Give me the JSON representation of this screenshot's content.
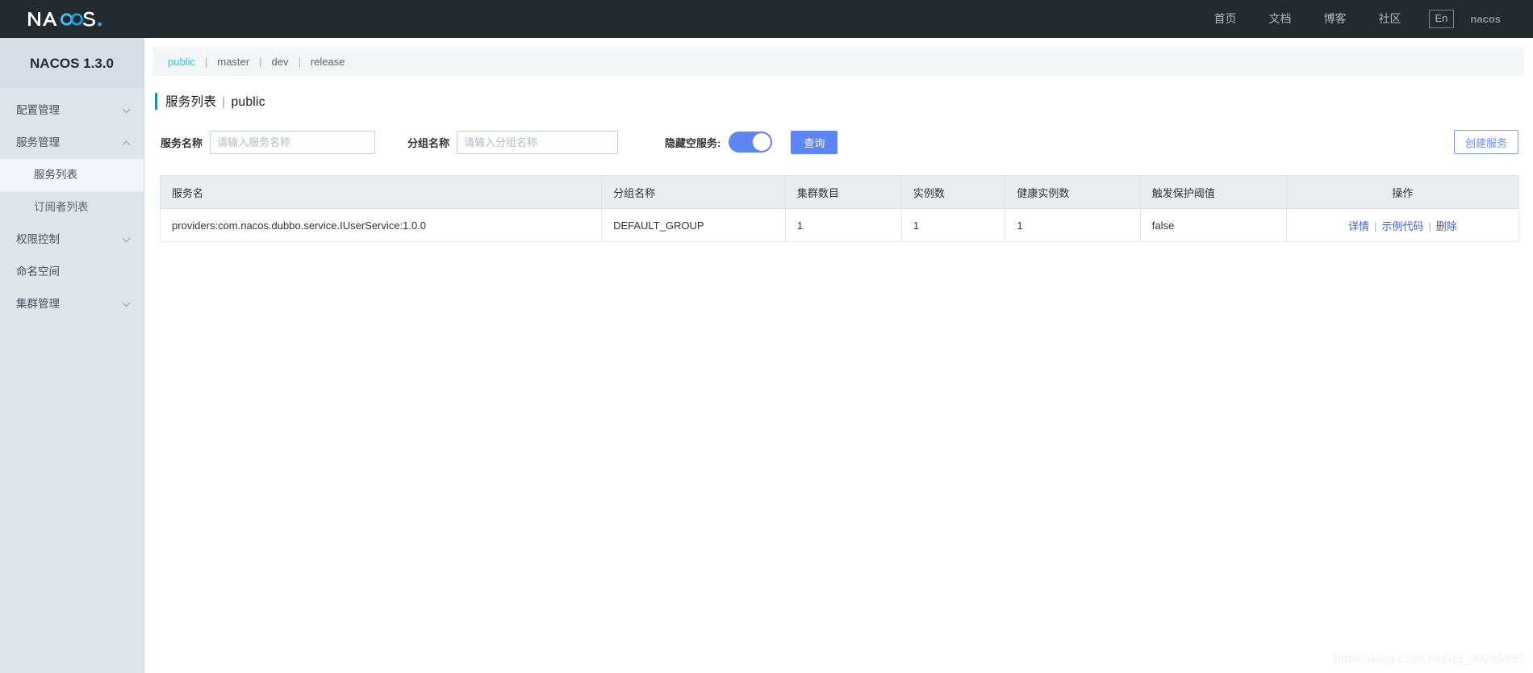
{
  "header": {
    "logo_text": "NACOS.",
    "nav": [
      {
        "label": "首页",
        "name": "home"
      },
      {
        "label": "文档",
        "name": "docs"
      },
      {
        "label": "博客",
        "name": "blog"
      },
      {
        "label": "社区",
        "name": "community"
      }
    ],
    "language_toggle": "En",
    "username": "nacos",
    "background_color": "#252a2f"
  },
  "sidebar": {
    "title": "NACOS 1.3.0",
    "items": [
      {
        "label": "配置管理",
        "chevron": "down",
        "type": "group"
      },
      {
        "label": "服务管理",
        "chevron": "up",
        "type": "group"
      },
      {
        "label": "服务列表",
        "type": "sub",
        "active": true
      },
      {
        "label": "订阅者列表",
        "type": "sub",
        "active": false
      },
      {
        "label": "权限控制",
        "chevron": "down",
        "type": "group"
      },
      {
        "label": "命名空间",
        "chevron": "none",
        "type": "group"
      },
      {
        "label": "集群管理",
        "chevron": "down",
        "type": "group"
      }
    ]
  },
  "namespaces": {
    "tabs": [
      {
        "label": "public",
        "active": true
      },
      {
        "label": "master",
        "active": false
      },
      {
        "label": "dev",
        "active": false
      },
      {
        "label": "release",
        "active": false
      }
    ],
    "separator": "|",
    "active_color": "#2fc3e3"
  },
  "page": {
    "title": "服务列表",
    "title_separator": "|",
    "title_suffix": "public",
    "accent_color": "#1f8fa8"
  },
  "toolbar": {
    "service_name_label": "服务名称",
    "service_name_value": "",
    "service_name_placeholder": "请输入服务名称",
    "group_name_label": "分组名称",
    "group_name_value": "",
    "group_name_placeholder": "请输入分组名称",
    "hide_empty_label": "隐藏空服务:",
    "hide_empty_checked": true,
    "query_label": "查询",
    "create_label": "创建服务",
    "primary_color": "#5e86f3"
  },
  "table": {
    "columns": [
      {
        "label": "服务名",
        "align": "left"
      },
      {
        "label": "分组名称",
        "align": "left"
      },
      {
        "label": "集群数目",
        "align": "left"
      },
      {
        "label": "实例数",
        "align": "left"
      },
      {
        "label": "健康实例数",
        "align": "left"
      },
      {
        "label": "触发保护阈值",
        "align": "left"
      },
      {
        "label": "操作",
        "align": "center"
      }
    ],
    "rows": [
      {
        "service_name": "providers:com.nacos.dubbo.service.IUserService:1.0.0",
        "group_name": "DEFAULT_GROUP",
        "cluster_count": "1",
        "instance_count": "1",
        "healthy_instance_count": "1",
        "protect_threshold": "false",
        "actions": [
          {
            "label": "详情",
            "name": "detail"
          },
          {
            "label": "示例代码",
            "name": "sample-code"
          },
          {
            "label": "删除",
            "name": "delete"
          }
        ],
        "action_separator": "|"
      }
    ]
  },
  "watermark": "https://blog.csdn.net/qq_30285985"
}
